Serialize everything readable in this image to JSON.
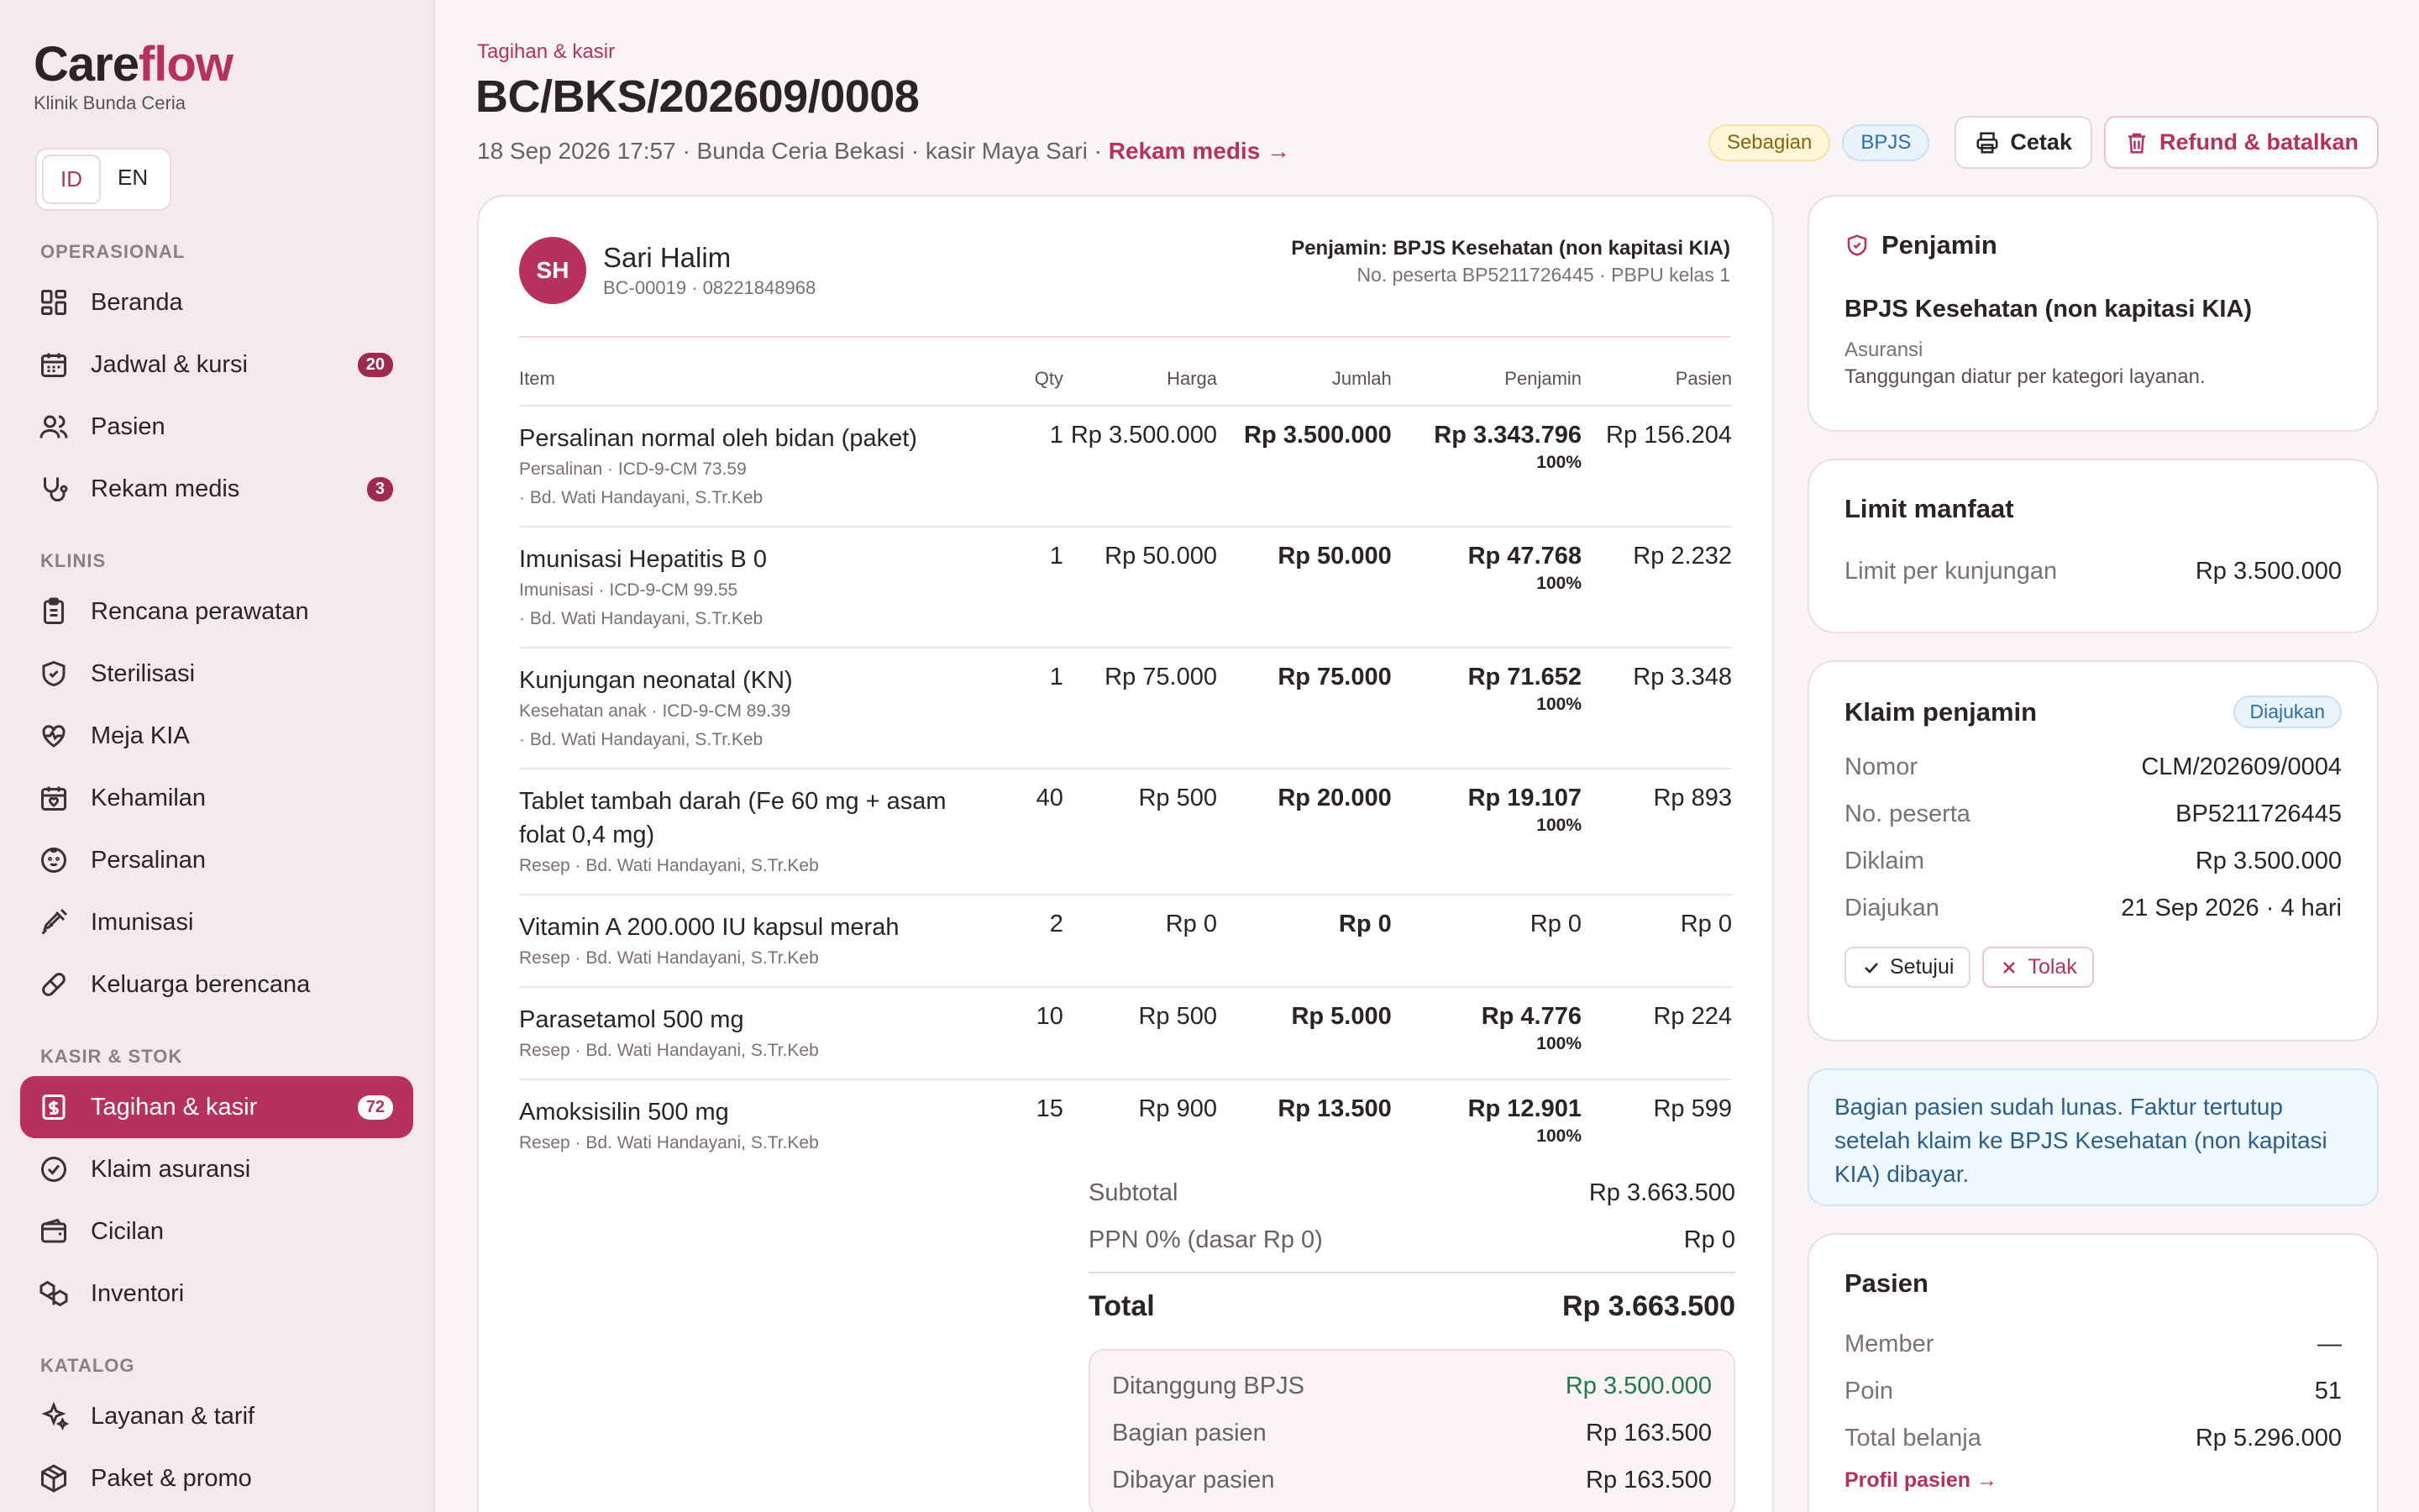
{
  "app": {
    "brand_a": "Care",
    "brand_b": "flow",
    "clinic": "Klinik Bunda Ceria"
  },
  "lang": {
    "id": "ID",
    "en": "EN"
  },
  "nav": {
    "sections": [
      {
        "label": "OPERASIONAL",
        "items": [
          {
            "label": "Beranda",
            "icon": "dashboard-icon"
          },
          {
            "label": "Jadwal & kursi",
            "icon": "calendar-icon",
            "badge": "20"
          },
          {
            "label": "Pasien",
            "icon": "users-icon"
          },
          {
            "label": "Rekam medis",
            "icon": "stethoscope-icon",
            "badge": "3"
          }
        ]
      },
      {
        "label": "KLINIS",
        "items": [
          {
            "label": "Rencana perawatan",
            "icon": "clipboard-icon"
          },
          {
            "label": "Sterilisasi",
            "icon": "shield-icon"
          },
          {
            "label": "Meja KIA",
            "icon": "heart-pulse-icon"
          },
          {
            "label": "Kehamilan",
            "icon": "calendar-heart-icon"
          },
          {
            "label": "Persalinan",
            "icon": "baby-icon"
          },
          {
            "label": "Imunisasi",
            "icon": "syringe-icon"
          },
          {
            "label": "Keluarga berencana",
            "icon": "pill-icon"
          }
        ]
      },
      {
        "label": "KASIR & STOK",
        "items": [
          {
            "label": "Tagihan & kasir",
            "icon": "receipt-icon",
            "badge": "72",
            "active": true
          },
          {
            "label": "Klaim asuransi",
            "icon": "check-circle-icon"
          },
          {
            "label": "Cicilan",
            "icon": "wallet-icon"
          },
          {
            "label": "Inventori",
            "icon": "boxes-icon"
          }
        ]
      },
      {
        "label": "KATALOG",
        "items": [
          {
            "label": "Layanan & tarif",
            "icon": "sparkles-icon"
          },
          {
            "label": "Paket & promo",
            "icon": "package-icon"
          }
        ]
      }
    ]
  },
  "header": {
    "breadcrumb": "Tagihan & kasir",
    "title": "BC/BKS/202609/0008",
    "meta": "18 Sep 2026 17:57 · Bunda Ceria Bekasi · kasir Maya Sari · ",
    "meta_link": "Rekam medis →",
    "status_badge": "Sebagian",
    "payer_badge": "BPJS",
    "print_label": "Cetak",
    "refund_label": "Refund & batalkan"
  },
  "patient": {
    "initials": "SH",
    "name": "Sari Halim",
    "sub": "BC-00019 · 08221848968",
    "guarantor": "Penjamin: BPJS Kesehatan (non kapitasi KIA)",
    "member_no": "No. peserta BP5211726445 · PBPU kelas 1"
  },
  "table": {
    "headers": [
      "Item",
      "Qty",
      "Harga",
      "Jumlah",
      "Penjamin",
      "Pasien"
    ],
    "rows": [
      {
        "name": "Persalinan normal oleh bidan (paket)",
        "sub1": "Persalinan  · ICD-9-CM 73.59",
        "sub2": "· Bd. Wati Handayani, S.Tr.Keb",
        "qty": "1",
        "price": "Rp 3.500.000",
        "amount": "Rp 3.500.000",
        "payer": "Rp 3.343.796",
        "pct": "100%",
        "patient": "Rp 156.204"
      },
      {
        "name": "Imunisasi Hepatitis B 0",
        "sub1": "Imunisasi  · ICD-9-CM 99.55",
        "sub2": "· Bd. Wati Handayani, S.Tr.Keb",
        "qty": "1",
        "price": "Rp 50.000",
        "amount": "Rp 50.000",
        "payer": "Rp 47.768",
        "pct": "100%",
        "patient": "Rp 2.232"
      },
      {
        "name": "Kunjungan neonatal (KN)",
        "sub1": "Kesehatan anak  · ICD-9-CM 89.39",
        "sub2": "· Bd. Wati Handayani, S.Tr.Keb",
        "qty": "1",
        "price": "Rp 75.000",
        "amount": "Rp 75.000",
        "payer": "Rp 71.652",
        "pct": "100%",
        "patient": "Rp 3.348"
      },
      {
        "name": "Tablet tambah darah (Fe 60 mg + asam folat 0,4 mg)",
        "sub1": "Resep  · Bd. Wati Handayani, S.Tr.Keb",
        "sub2": "",
        "qty": "40",
        "price": "Rp 500",
        "amount": "Rp 20.000",
        "payer": "Rp 19.107",
        "pct": "100%",
        "patient": "Rp 893"
      },
      {
        "name": "Vitamin A 200.000 IU kapsul merah",
        "sub1": "Resep  · Bd. Wati Handayani, S.Tr.Keb",
        "sub2": "",
        "qty": "2",
        "price": "Rp 0",
        "amount": "Rp 0",
        "payer": "Rp 0",
        "pct": "",
        "patient": "Rp 0"
      },
      {
        "name": "Parasetamol 500 mg",
        "sub1": "Resep  · Bd. Wati Handayani, S.Tr.Keb",
        "sub2": "",
        "qty": "10",
        "price": "Rp 500",
        "amount": "Rp 5.000",
        "payer": "Rp 4.776",
        "pct": "100%",
        "patient": "Rp 224"
      },
      {
        "name": "Amoksisilin 500 mg",
        "sub1": "Resep  · Bd. Wati Handayani, S.Tr.Keb",
        "sub2": "",
        "qty": "15",
        "price": "Rp 900",
        "amount": "Rp 13.500",
        "payer": "Rp 12.901",
        "pct": "100%",
        "patient": "Rp 599"
      }
    ]
  },
  "totals": {
    "subtotal_label": "Subtotal",
    "subtotal": "Rp 3.663.500",
    "tax_label": "PPN 0% (dasar Rp 0)",
    "tax": "Rp 0",
    "total_label": "Total",
    "total": "Rp 3.663.500",
    "covered_label": "Ditanggung BPJS",
    "covered": "Rp 3.500.000",
    "patient_part_label": "Bagian pasien",
    "patient_part": "Rp 163.500",
    "paid_label": "Dibayar pasien",
    "paid": "Rp 163.500"
  },
  "guarantor_card": {
    "title": "Penjamin",
    "name": "BPJS Kesehatan (non kapitasi KIA)",
    "type": "Asuransi",
    "note": "Tanggungan diatur per kategori layanan."
  },
  "limit_card": {
    "title": "Limit manfaat",
    "label": "Limit per kunjungan",
    "value": "Rp 3.500.000"
  },
  "claim_card": {
    "title": "Klaim penjamin",
    "status": "Diajukan",
    "rows": [
      {
        "k": "Nomor",
        "v": "CLM/202609/0004"
      },
      {
        "k": "No. peserta",
        "v": "BP5211726445"
      },
      {
        "k": "Diklaim",
        "v": "Rp 3.500.000"
      },
      {
        "k": "Diajukan",
        "v": "21 Sep 2026 · 4 hari"
      }
    ],
    "approve": "Setujui",
    "reject": "Tolak"
  },
  "info": "Bagian pasien sudah lunas. Faktur tertutup setelah klaim ke BPJS Kesehatan (non kapitasi KIA) dibayar.",
  "patient_card": {
    "title": "Pasien",
    "rows": [
      {
        "k": "Member",
        "v": "—"
      },
      {
        "k": "Poin",
        "v": "51"
      },
      {
        "k": "Total belanja",
        "v": "Rp 5.296.000"
      }
    ],
    "link": "Profil pasien →"
  },
  "colors": {
    "accent": "#b7305e",
    "green": "#1f7a4d",
    "blue": "#2d6fa8"
  }
}
